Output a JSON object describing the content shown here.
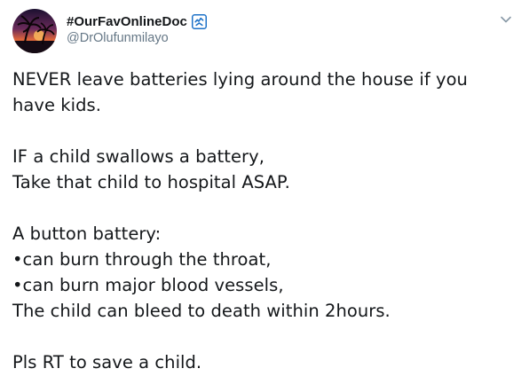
{
  "tweet": {
    "display_name": "#OurFavOnlineDoc",
    "handle": "@DrOlufunmilayo",
    "badge_icon": "pinned-badge-icon",
    "menu_icon": "chevron-down-icon",
    "avatar_icon": "palm-sunset-avatar-icon",
    "lines": [
      "NEVER leave batteries lying around the house if you",
      "have kids.",
      "",
      "IF a child swallows a battery,",
      "Take that child to hospital ASAP.",
      "",
      "A button battery:",
      "•can burn through the throat,",
      "•can burn major blood vessels,",
      "The child can bleed to death within 2hours.",
      "",
      "Pls RT to save a child."
    ]
  },
  "colors": {
    "text": "#14171a",
    "secondary": "#657786",
    "badge": "#1da1f2"
  }
}
